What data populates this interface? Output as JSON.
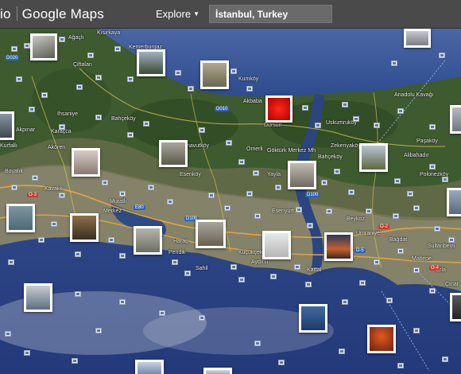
{
  "header": {
    "brand_left": "io",
    "brand_right": "Google Maps",
    "explore_label": "Explore",
    "search_value": "İstanbul, Turkey"
  },
  "map": {
    "places": [
      "Ağaçlı",
      "Kısırkaya",
      "Çiftalan",
      "Kemerburgaz",
      "Kumköy",
      "Akbaba",
      "Dursun",
      "Uskumruköy",
      "Ihsaniye",
      "Bahçeköy",
      "Akpınar",
      "Anadolu Kavağı",
      "Paşaköy",
      "Karaçca",
      "Polonezköy",
      "Kurfallı",
      "Boyalık",
      "Akören",
      "Arnavutköy",
      "Ömerli",
      "Göktürk Merkez Mh",
      "Zekeriyaköy",
      "Bahçeköy",
      "Alibahadır",
      "Yayla",
      "Sarıyer",
      "Esenköy",
      "Kavaklı",
      "Muratlı",
      "Merkez",
      "Esenyurt",
      "Ümraniye",
      "Bağdat",
      "Haraç",
      "Küçükçekmece",
      "Beykoz",
      "Sultanbeyli",
      "Maltepe",
      "Tuzla",
      "Aydınlı",
      "Pendik",
      "Kartal",
      "Sahil",
      "Çınar"
    ],
    "roads": [
      "D020",
      "D010",
      "D100",
      "O-2",
      "O-3",
      "O-4",
      "D-5",
      "E80",
      "D100"
    ]
  },
  "colors": {
    "topbar": "#4a4a4a",
    "sea": "#2f4a86",
    "land": "#3d5a2e",
    "urban": "#8f8a72"
  }
}
